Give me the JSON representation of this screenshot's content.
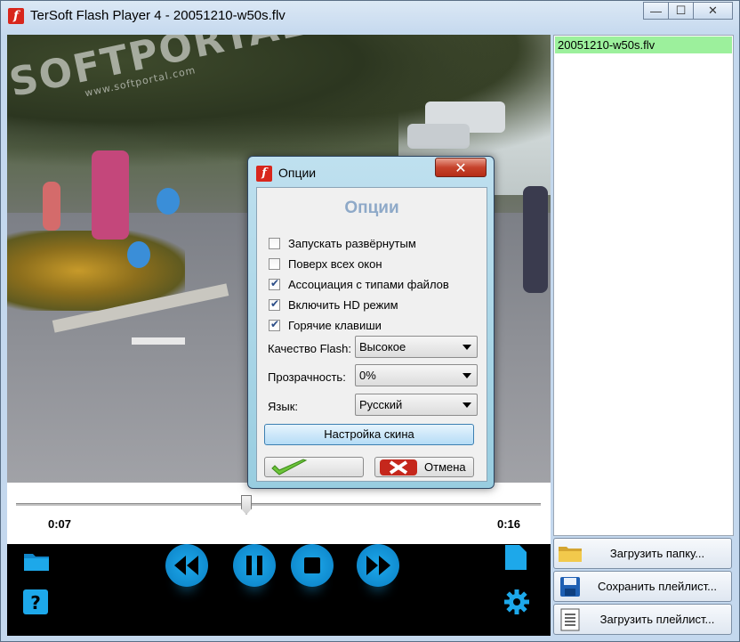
{
  "window": {
    "title": "TerSoft Flash Player 4 - 20051210-w50s.flv",
    "app_icon": "flash-icon",
    "minimize_label": "—",
    "maximize_label": "☐",
    "close_label": "✕"
  },
  "video": {
    "watermark": "SOFTPORTAL",
    "watermark_url": "www.softportal.com"
  },
  "seek": {
    "current_time": "0:07",
    "total_time": "0:16",
    "progress": 0.44
  },
  "controls": {
    "open_folder_icon": "folder-icon",
    "help_icon": "help-icon",
    "rewind_icon": "rewind-icon",
    "pause_icon": "pause-icon",
    "stop_icon": "stop-icon",
    "forward_icon": "fast-forward-icon",
    "file_icon": "file-icon",
    "settings_icon": "gear-icon"
  },
  "playlist": {
    "items": [
      "20051210-w50s.flv"
    ],
    "load_folder_label": "Загрузить папку...",
    "save_playlist_label": "Сохранить плейлист...",
    "load_playlist_label": "Загрузить плейлист..."
  },
  "dialog": {
    "title": "Опции",
    "heading": "Опции",
    "close_label": "✕",
    "options": [
      {
        "label": "Запускать развёрнутым",
        "checked": false
      },
      {
        "label": "Поверх всех окон",
        "checked": false
      },
      {
        "label": "Ассоциация с типами файлов",
        "checked": true
      },
      {
        "label": "Включить HD режим",
        "checked": true
      },
      {
        "label": "Горячие клавиши",
        "checked": true
      }
    ],
    "quality_label": "Качество Flash:",
    "quality_value": "Высокое",
    "transparency_label": "Прозрачность:",
    "transparency_value": "0%",
    "language_label": "Язык:",
    "language_value": "Русский",
    "skin_button": "Настройка скина",
    "cancel_button": "Отмена"
  },
  "colors": {
    "accent": "#1da8ea",
    "playlist_selected": "#9cf09c",
    "dialog_heading": "#8ea9c8"
  }
}
